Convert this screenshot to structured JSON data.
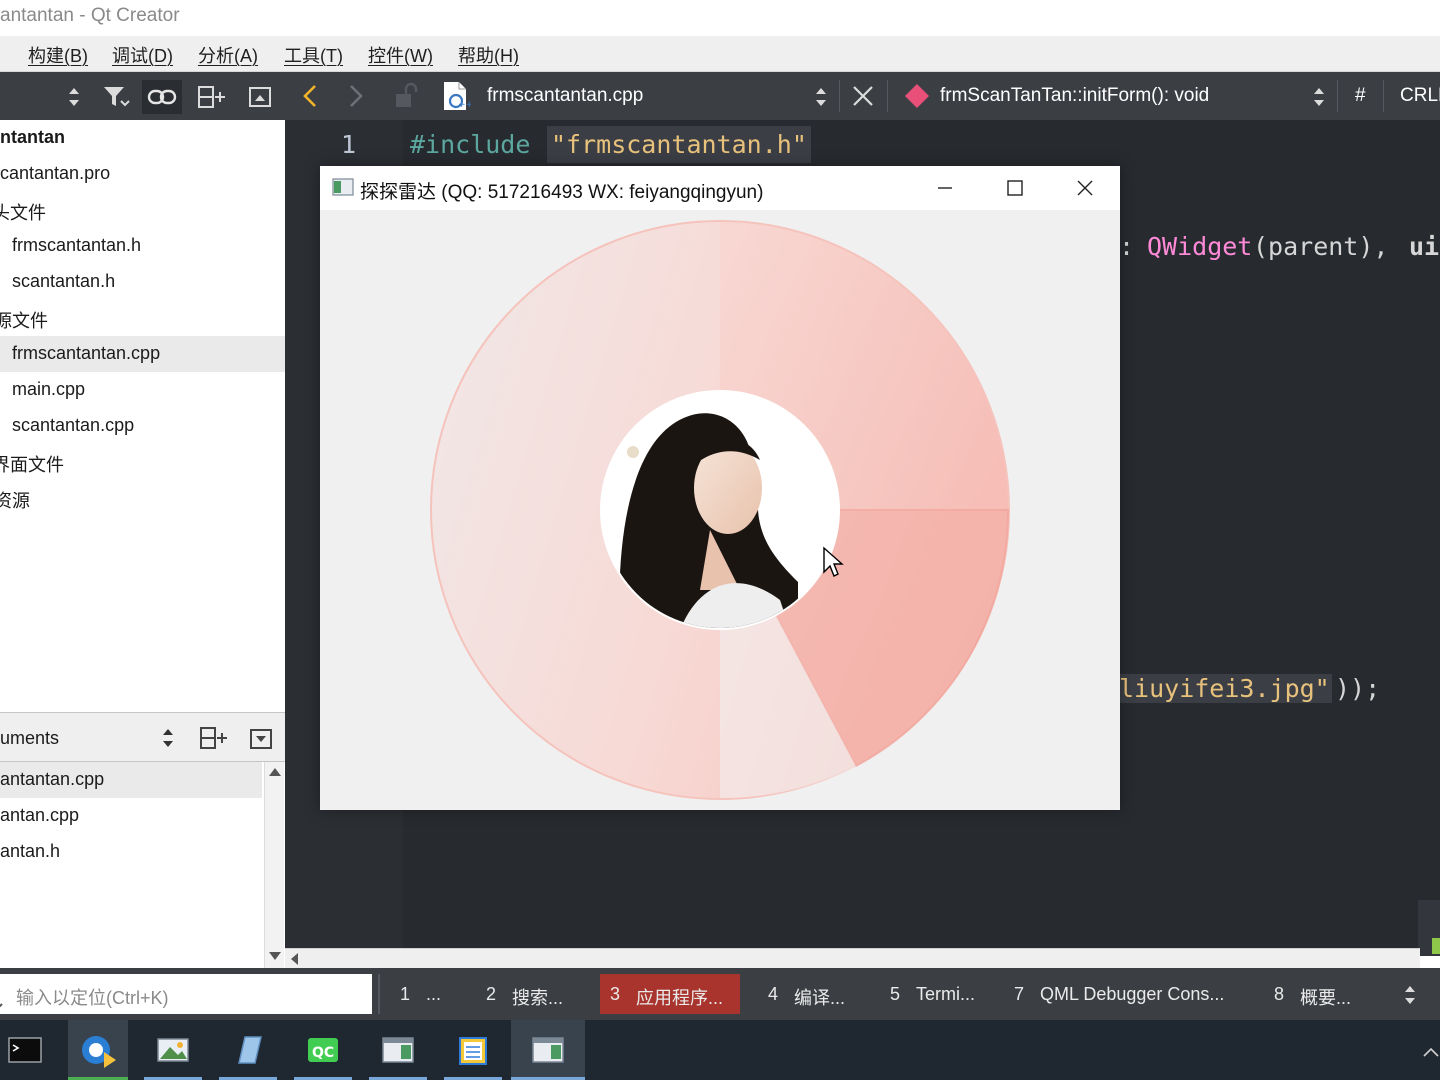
{
  "window": {
    "title": "antantan - Qt Creator"
  },
  "menu": [
    "构建(B)",
    "调试(D)",
    "分析(A)",
    "工具(T)",
    "控件(W)",
    "帮助(H)"
  ],
  "project_tree": {
    "items": [
      {
        "label": "ntantan",
        "bold": true
      },
      {
        "label": "cantantan.pro"
      },
      {
        "label": "头文件"
      },
      {
        "label": "frmscantantan.h"
      },
      {
        "label": "scantantan.h"
      },
      {
        "label": "源文件"
      },
      {
        "label": "frmscantantan.cpp",
        "selected": true
      },
      {
        "label": "main.cpp"
      },
      {
        "label": "scantantan.cpp"
      },
      {
        "label": "界面文件"
      },
      {
        "label": "资源"
      }
    ]
  },
  "open_documents": {
    "label": "uments",
    "items": [
      "antantan.cpp",
      "antan.cpp",
      "antan.h"
    ]
  },
  "editor_toolbar": {
    "file": "frmscantantan.cpp",
    "symbol": "frmScanTanTan::initForm(): void",
    "hash": "#",
    "line_ending": "CRLF"
  },
  "editor": {
    "line_number": "1",
    "directive": "#include",
    "include_file": "\"frmscantantan.h\"",
    "frag_colon": ": ",
    "frag_qwidget": "QWidget",
    "frag_paren": "(parent), ",
    "frag_ui": "ui",
    "frag_jpg": "liuyifei3.jpg\"",
    "frag_end": "));"
  },
  "dialog": {
    "title": "探探雷达 (QQ: 517216493 WX: feiyangqingyun)",
    "radar_color": "#f4a9a0"
  },
  "locator": {
    "placeholder": "输入以定位(Ctrl+K)"
  },
  "output_tabs": [
    {
      "num": "1",
      "label": "..."
    },
    {
      "num": "2",
      "label": "搜索..."
    },
    {
      "num": "3",
      "label": "应用程序...",
      "active": true
    },
    {
      "num": "4",
      "label": "编译..."
    },
    {
      "num": "5",
      "label": "Termi..."
    },
    {
      "num": "7",
      "label": "QML Debugger Cons..."
    },
    {
      "num": "8",
      "label": "概要..."
    }
  ],
  "taskbar": {
    "items": [
      "terminal-app",
      "browser-app",
      "photos-app",
      "notes-app",
      "qtcreator-app",
      "window-app",
      "notepad-app",
      "radar-app"
    ],
    "qc_label": "QC"
  }
}
